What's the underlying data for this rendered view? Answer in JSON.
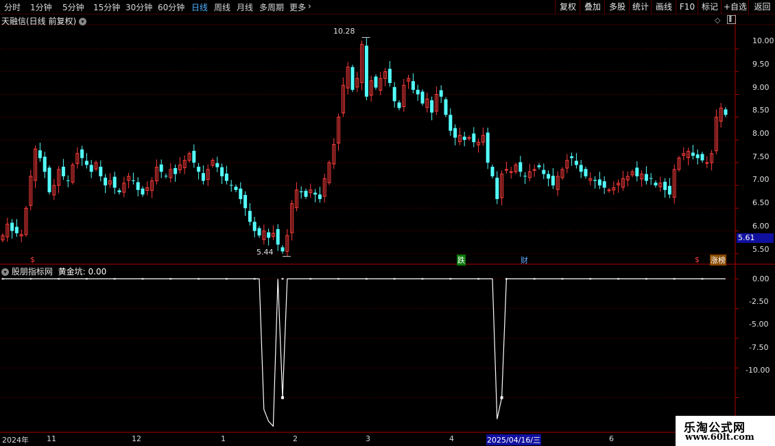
{
  "toolbar": {
    "periods": [
      "分时",
      "1分钟",
      "5分钟",
      "15分钟",
      "30分钟",
      "60分钟",
      "日线",
      "周线",
      "月线",
      "多周期",
      "更多"
    ],
    "active_period": "日线",
    "buttons": [
      "复权",
      "叠加",
      "多股",
      "统计",
      "画线",
      "F10",
      "标记",
      "+自选",
      "返回"
    ]
  },
  "main_panel": {
    "title": "天融信(日线 前复权)",
    "high_label": "10.28",
    "low_label": "5.44",
    "price_tag": "5.61",
    "markers": [
      "$",
      "跌",
      "财",
      "$",
      "涨榜"
    ]
  },
  "indicator_panel": {
    "title": "股朋指标网",
    "series_label": "黄金坑:",
    "series_value": "0.00"
  },
  "price_axis": [
    "10.00",
    "9.50",
    "9.00",
    "8.50",
    "8.00",
    "7.50",
    "7.00",
    "6.50",
    "6.00",
    "5.50"
  ],
  "indicator_axis": [
    "0.00",
    "-2.50",
    "-5.00",
    "-7.50",
    "-10.00"
  ],
  "date_axis": {
    "labels": [
      "2024年",
      "11",
      "12",
      "1",
      "2",
      "3",
      "4",
      "2025/04/16/三",
      "6"
    ]
  },
  "watermark": {
    "line1": "乐淘公式网",
    "line2": "www.60lt.com"
  },
  "colors": {
    "up": "#ff3c3c",
    "down": "#54ffff",
    "grid": "#7a0000",
    "active": "#4fb2ff"
  },
  "chart_data": [
    {
      "type": "candlestick",
      "title": "天融信(日线 前复权)",
      "ylim": [
        5.3,
        10.5
      ],
      "annotations": {
        "high": 10.28,
        "low": 5.44,
        "current": 5.61
      },
      "closes": [
        5.9,
        6.15,
        6.0,
        5.95,
        5.92,
        6.5,
        7.2,
        7.8,
        7.6,
        7.3,
        6.85,
        7.0,
        7.35,
        7.2,
        7.1,
        7.45,
        7.7,
        7.6,
        7.45,
        7.3,
        7.5,
        7.2,
        7.0,
        7.1,
        6.95,
        6.85,
        7.05,
        7.2,
        7.1,
        6.9,
        6.8,
        6.95,
        7.1,
        7.4,
        7.3,
        7.2,
        7.35,
        7.25,
        7.45,
        7.55,
        7.7,
        7.5,
        7.3,
        7.1,
        7.35,
        7.55,
        7.4,
        7.2,
        7.1,
        7.0,
        6.9,
        6.7,
        6.5,
        6.2,
        6.0,
        5.9,
        6.0,
        5.85,
        5.95,
        5.7,
        5.55,
        5.9,
        6.6,
        6.9,
        6.85,
        6.75,
        6.9,
        6.8,
        6.7,
        7.15,
        7.5,
        7.9,
        8.5,
        9.2,
        9.6,
        9.1,
        9.35,
        10.1,
        8.95,
        9.3,
        9.15,
        9.35,
        9.5,
        9.25,
        8.85,
        8.7,
        9.2,
        9.35,
        9.1,
        9.0,
        8.8,
        8.9,
        8.6,
        9.0,
        8.95,
        8.55,
        8.2,
        8.05,
        8.1,
        8.0,
        8.05,
        7.95,
        7.95,
        8.1,
        7.5,
        7.2,
        6.7,
        7.25,
        7.35,
        7.3,
        7.45,
        7.3,
        7.2,
        7.3,
        7.35,
        7.4,
        7.25,
        7.15,
        7.0,
        7.2,
        7.35,
        7.55,
        7.6,
        7.45,
        7.3,
        7.2,
        7.15,
        7.1,
        7.0,
        6.95,
        6.9,
        6.95,
        7.05,
        7.15,
        7.2,
        7.3,
        7.2,
        7.25,
        7.1,
        7.15,
        7.0,
        7.05,
        6.9,
        6.8,
        7.35,
        7.6,
        7.7,
        7.75,
        7.65,
        7.6,
        7.55,
        7.5,
        7.7,
        8.5,
        8.7,
        8.55
      ]
    },
    {
      "type": "line",
      "series": [
        {
          "name": "黄金坑",
          "values_note": "0 baseline with two dips",
          "dips": [
            -12.5,
            -11.8
          ]
        }
      ],
      "ylim": [
        -12.8,
        0.6
      ],
      "x": [
        0,
        1,
        2,
        3,
        4,
        5,
        6,
        7,
        8,
        9,
        10,
        11,
        12,
        13,
        14,
        15,
        16,
        17,
        18,
        19,
        20,
        21,
        22,
        23,
        24,
        25,
        26,
        27,
        28,
        29,
        30,
        31,
        32,
        33,
        34,
        35,
        36,
        37,
        38,
        39,
        40,
        41,
        42,
        43,
        44,
        45,
        46,
        47,
        48,
        49,
        50,
        51,
        52,
        53,
        54,
        55,
        56,
        57,
        58,
        59,
        60,
        61,
        62,
        63,
        64,
        65,
        66,
        67,
        68,
        69,
        70,
        71,
        72,
        73,
        74,
        75,
        76,
        77,
        78,
        79,
        80,
        81,
        82,
        83,
        84,
        85,
        86,
        87,
        88,
        89,
        90,
        91,
        92,
        93,
        94,
        95,
        96,
        97,
        98,
        99,
        100,
        101,
        102,
        103,
        104,
        105,
        106,
        107,
        108,
        109,
        110,
        111,
        112,
        113,
        114,
        115,
        116,
        117,
        118,
        119,
        120,
        121,
        122,
        123,
        124,
        125,
        126,
        127,
        128,
        129,
        130,
        131,
        132,
        133,
        134,
        135,
        136,
        137,
        138,
        139,
        140,
        141,
        142,
        143,
        144,
        145,
        146,
        147,
        148,
        149,
        150,
        151,
        152,
        153,
        154,
        155
      ],
      "y": [
        0,
        0,
        0,
        0,
        0,
        0,
        0,
        0,
        0,
        0,
        0,
        0,
        0,
        0,
        0,
        0,
        0,
        0,
        0,
        0,
        0,
        0,
        0,
        0,
        0,
        0,
        0,
        0,
        0,
        0,
        0,
        0,
        0,
        0,
        0,
        0,
        0,
        0,
        0,
        0,
        0,
        0,
        0,
        0,
        0,
        0,
        0,
        0,
        0,
        0,
        0,
        0,
        0,
        0,
        0,
        0,
        0,
        0,
        0,
        0,
        0,
        0,
        0,
        0,
        0,
        0,
        0,
        0,
        0,
        0,
        0,
        0,
        0,
        0,
        0,
        0,
        0,
        0,
        0,
        0,
        0,
        0,
        0,
        0,
        0,
        0,
        0,
        0,
        0,
        0,
        0,
        0,
        0,
        0,
        0,
        0,
        0,
        0,
        0,
        0,
        0,
        0,
        0,
        0,
        0,
        0,
        0,
        0,
        0,
        0,
        0,
        0,
        0,
        0,
        0,
        0,
        0,
        0,
        0,
        0,
        0,
        0,
        0,
        0,
        0,
        0,
        0,
        0,
        0,
        0,
        0,
        0,
        0,
        0,
        0,
        0,
        0,
        0,
        0,
        0,
        0,
        0,
        0,
        0,
        0,
        0,
        0,
        0,
        0,
        0,
        0,
        0,
        0,
        0,
        0,
        0
      ]
    }
  ]
}
